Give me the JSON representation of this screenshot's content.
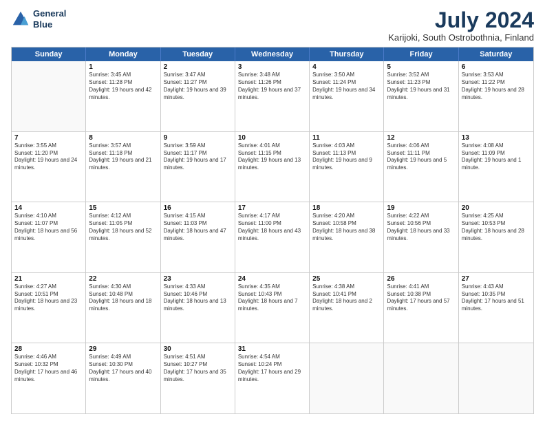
{
  "logo": {
    "line1": "General",
    "line2": "Blue"
  },
  "title": "July 2024",
  "subtitle": "Karijoki, South Ostrobothnia, Finland",
  "header": {
    "days": [
      "Sunday",
      "Monday",
      "Tuesday",
      "Wednesday",
      "Thursday",
      "Friday",
      "Saturday"
    ]
  },
  "weeks": [
    [
      {
        "day": "",
        "empty": true
      },
      {
        "day": "1",
        "sunrise": "3:45 AM",
        "sunset": "11:28 PM",
        "daylight": "19 hours and 42 minutes."
      },
      {
        "day": "2",
        "sunrise": "3:47 AM",
        "sunset": "11:27 PM",
        "daylight": "19 hours and 39 minutes."
      },
      {
        "day": "3",
        "sunrise": "3:48 AM",
        "sunset": "11:26 PM",
        "daylight": "19 hours and 37 minutes."
      },
      {
        "day": "4",
        "sunrise": "3:50 AM",
        "sunset": "11:24 PM",
        "daylight": "19 hours and 34 minutes."
      },
      {
        "day": "5",
        "sunrise": "3:52 AM",
        "sunset": "11:23 PM",
        "daylight": "19 hours and 31 minutes."
      },
      {
        "day": "6",
        "sunrise": "3:53 AM",
        "sunset": "11:22 PM",
        "daylight": "19 hours and 28 minutes."
      }
    ],
    [
      {
        "day": "7",
        "sunrise": "3:55 AM",
        "sunset": "11:20 PM",
        "daylight": "19 hours and 24 minutes."
      },
      {
        "day": "8",
        "sunrise": "3:57 AM",
        "sunset": "11:18 PM",
        "daylight": "19 hours and 21 minutes."
      },
      {
        "day": "9",
        "sunrise": "3:59 AM",
        "sunset": "11:17 PM",
        "daylight": "19 hours and 17 minutes."
      },
      {
        "day": "10",
        "sunrise": "4:01 AM",
        "sunset": "11:15 PM",
        "daylight": "19 hours and 13 minutes."
      },
      {
        "day": "11",
        "sunrise": "4:03 AM",
        "sunset": "11:13 PM",
        "daylight": "19 hours and 9 minutes."
      },
      {
        "day": "12",
        "sunrise": "4:06 AM",
        "sunset": "11:11 PM",
        "daylight": "19 hours and 5 minutes."
      },
      {
        "day": "13",
        "sunrise": "4:08 AM",
        "sunset": "11:09 PM",
        "daylight": "19 hours and 1 minute."
      }
    ],
    [
      {
        "day": "14",
        "sunrise": "4:10 AM",
        "sunset": "11:07 PM",
        "daylight": "18 hours and 56 minutes."
      },
      {
        "day": "15",
        "sunrise": "4:12 AM",
        "sunset": "11:05 PM",
        "daylight": "18 hours and 52 minutes."
      },
      {
        "day": "16",
        "sunrise": "4:15 AM",
        "sunset": "11:03 PM",
        "daylight": "18 hours and 47 minutes."
      },
      {
        "day": "17",
        "sunrise": "4:17 AM",
        "sunset": "11:00 PM",
        "daylight": "18 hours and 43 minutes."
      },
      {
        "day": "18",
        "sunrise": "4:20 AM",
        "sunset": "10:58 PM",
        "daylight": "18 hours and 38 minutes."
      },
      {
        "day": "19",
        "sunrise": "4:22 AM",
        "sunset": "10:56 PM",
        "daylight": "18 hours and 33 minutes."
      },
      {
        "day": "20",
        "sunrise": "4:25 AM",
        "sunset": "10:53 PM",
        "daylight": "18 hours and 28 minutes."
      }
    ],
    [
      {
        "day": "21",
        "sunrise": "4:27 AM",
        "sunset": "10:51 PM",
        "daylight": "18 hours and 23 minutes."
      },
      {
        "day": "22",
        "sunrise": "4:30 AM",
        "sunset": "10:48 PM",
        "daylight": "18 hours and 18 minutes."
      },
      {
        "day": "23",
        "sunrise": "4:33 AM",
        "sunset": "10:46 PM",
        "daylight": "18 hours and 13 minutes."
      },
      {
        "day": "24",
        "sunrise": "4:35 AM",
        "sunset": "10:43 PM",
        "daylight": "18 hours and 7 minutes."
      },
      {
        "day": "25",
        "sunrise": "4:38 AM",
        "sunset": "10:41 PM",
        "daylight": "18 hours and 2 minutes."
      },
      {
        "day": "26",
        "sunrise": "4:41 AM",
        "sunset": "10:38 PM",
        "daylight": "17 hours and 57 minutes."
      },
      {
        "day": "27",
        "sunrise": "4:43 AM",
        "sunset": "10:35 PM",
        "daylight": "17 hours and 51 minutes."
      }
    ],
    [
      {
        "day": "28",
        "sunrise": "4:46 AM",
        "sunset": "10:32 PM",
        "daylight": "17 hours and 46 minutes."
      },
      {
        "day": "29",
        "sunrise": "4:49 AM",
        "sunset": "10:30 PM",
        "daylight": "17 hours and 40 minutes."
      },
      {
        "day": "30",
        "sunrise": "4:51 AM",
        "sunset": "10:27 PM",
        "daylight": "17 hours and 35 minutes."
      },
      {
        "day": "31",
        "sunrise": "4:54 AM",
        "sunset": "10:24 PM",
        "daylight": "17 hours and 29 minutes."
      },
      {
        "day": "",
        "empty": true
      },
      {
        "day": "",
        "empty": true
      },
      {
        "day": "",
        "empty": true
      }
    ]
  ]
}
